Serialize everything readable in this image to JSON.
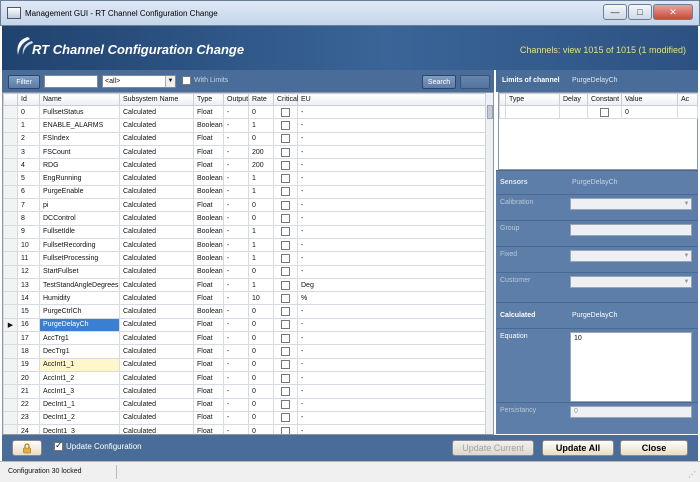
{
  "window": {
    "title": "Management GUI - RT Channel Configuration Change"
  },
  "header": {
    "title": "RT Channel Configuration Change",
    "channel_count": "Channels: view 1015 of 1015 (1 modified)"
  },
  "toolbar": {
    "filter_label": "Filter",
    "filter_value": "",
    "select_value": "<all>",
    "with_limits_label": "With Limits",
    "search_label": "Search",
    "reset_label": ""
  },
  "table": {
    "columns": [
      "Id",
      "Name",
      "Subsystem Name",
      "Type",
      "Output",
      "Rate",
      "Critical",
      "EU"
    ],
    "rows": [
      {
        "id": "0",
        "name": "FullsetStatus",
        "sub": "Calculated",
        "type": "Float",
        "output": "-",
        "rate": "0",
        "eu": "-"
      },
      {
        "id": "1",
        "name": "ENABLE_ALARMS",
        "sub": "Calculated",
        "type": "Boolean",
        "output": "-",
        "rate": "1",
        "eu": "-"
      },
      {
        "id": "2",
        "name": "FSIndex",
        "sub": "Calculated",
        "type": "Float",
        "output": "-",
        "rate": "0",
        "eu": "-"
      },
      {
        "id": "3",
        "name": "FSCount",
        "sub": "Calculated",
        "type": "Float",
        "output": "-",
        "rate": "200",
        "eu": "-"
      },
      {
        "id": "4",
        "name": "RDG",
        "sub": "Calculated",
        "type": "Float",
        "output": "-",
        "rate": "200",
        "eu": "-"
      },
      {
        "id": "5",
        "name": "EngRunning",
        "sub": "Calculated",
        "type": "Boolean",
        "output": "-",
        "rate": "1",
        "eu": "-"
      },
      {
        "id": "6",
        "name": "PurgeEnable",
        "sub": "Calculated",
        "type": "Boolean",
        "output": "-",
        "rate": "1",
        "eu": "-"
      },
      {
        "id": "7",
        "name": "pi",
        "sub": "Calculated",
        "type": "Float",
        "output": "-",
        "rate": "0",
        "eu": "-"
      },
      {
        "id": "8",
        "name": "DCControl",
        "sub": "Calculated",
        "type": "Boolean",
        "output": "-",
        "rate": "0",
        "eu": "-"
      },
      {
        "id": "9",
        "name": "FullsetIdle",
        "sub": "Calculated",
        "type": "Boolean",
        "output": "-",
        "rate": "1",
        "eu": "-"
      },
      {
        "id": "10",
        "name": "FullsetRecording",
        "sub": "Calculated",
        "type": "Boolean",
        "output": "-",
        "rate": "1",
        "eu": "-"
      },
      {
        "id": "11",
        "name": "FullsetProcessing",
        "sub": "Calculated",
        "type": "Boolean",
        "output": "-",
        "rate": "1",
        "eu": "-"
      },
      {
        "id": "12",
        "name": "StartFullset",
        "sub": "Calculated",
        "type": "Boolean",
        "output": "-",
        "rate": "0",
        "eu": "-"
      },
      {
        "id": "13",
        "name": "TestStandAngleDegrees",
        "sub": "Calculated",
        "type": "Float",
        "output": "-",
        "rate": "1",
        "eu": "Deg"
      },
      {
        "id": "14",
        "name": "Humidity",
        "sub": "Calculated",
        "type": "Float",
        "output": "-",
        "rate": "10",
        "eu": "%"
      },
      {
        "id": "15",
        "name": "PurgeCtrlCh",
        "sub": "Calculated",
        "type": "Boolean",
        "output": "-",
        "rate": "0",
        "eu": "-"
      },
      {
        "id": "16",
        "name": "PurgeDelayCh",
        "sub": "Calculated",
        "type": "Float",
        "output": "-",
        "rate": "0",
        "eu": "-"
      },
      {
        "id": "17",
        "name": "AccTrg1",
        "sub": "Calculated",
        "type": "Float",
        "output": "-",
        "rate": "0",
        "eu": "-"
      },
      {
        "id": "18",
        "name": "DecTrg1",
        "sub": "Calculated",
        "type": "Float",
        "output": "-",
        "rate": "0",
        "eu": "-"
      },
      {
        "id": "19",
        "name": "AccInt1_1",
        "sub": "Calculated",
        "type": "Float",
        "output": "-",
        "rate": "0",
        "eu": "-"
      },
      {
        "id": "20",
        "name": "AccInt1_2",
        "sub": "Calculated",
        "type": "Float",
        "output": "-",
        "rate": "0",
        "eu": "-"
      },
      {
        "id": "21",
        "name": "AccInt1_3",
        "sub": "Calculated",
        "type": "Float",
        "output": "-",
        "rate": "0",
        "eu": "-"
      },
      {
        "id": "22",
        "name": "DecInt1_1",
        "sub": "Calculated",
        "type": "Float",
        "output": "-",
        "rate": "0",
        "eu": "-"
      },
      {
        "id": "23",
        "name": "DecInt1_2",
        "sub": "Calculated",
        "type": "Float",
        "output": "-",
        "rate": "0",
        "eu": "-"
      },
      {
        "id": "24",
        "name": "DecInt1_3",
        "sub": "Calculated",
        "type": "Float",
        "output": "-",
        "rate": "0",
        "eu": "-"
      }
    ],
    "selected_marker": "▶"
  },
  "limits": {
    "title": "Limits of channel",
    "channel": "PurgeDelayCh",
    "columns": [
      "Type",
      "Delay",
      "Constant",
      "Value",
      "Ac"
    ],
    "row_value": "0"
  },
  "sensors": {
    "title": "Sensors",
    "channel": "PurgeDelayCh",
    "calibration_label": "Calibration",
    "group_label": "Group",
    "fixed_label": "Fixed",
    "customer_label": "Customer"
  },
  "calculated": {
    "title": "Calculated",
    "channel": "PurgeDelayCh",
    "equation_label": "Equation",
    "equation_value": "10",
    "persistancy_label": "Persistancy",
    "persistancy_value": "0"
  },
  "bottom": {
    "update_configuration_label": "Update Configuration",
    "update_current_label": "Update Current",
    "update_all_label": "Update All",
    "close_label": "Close"
  },
  "status": {
    "text": "Configuration 30 locked"
  }
}
